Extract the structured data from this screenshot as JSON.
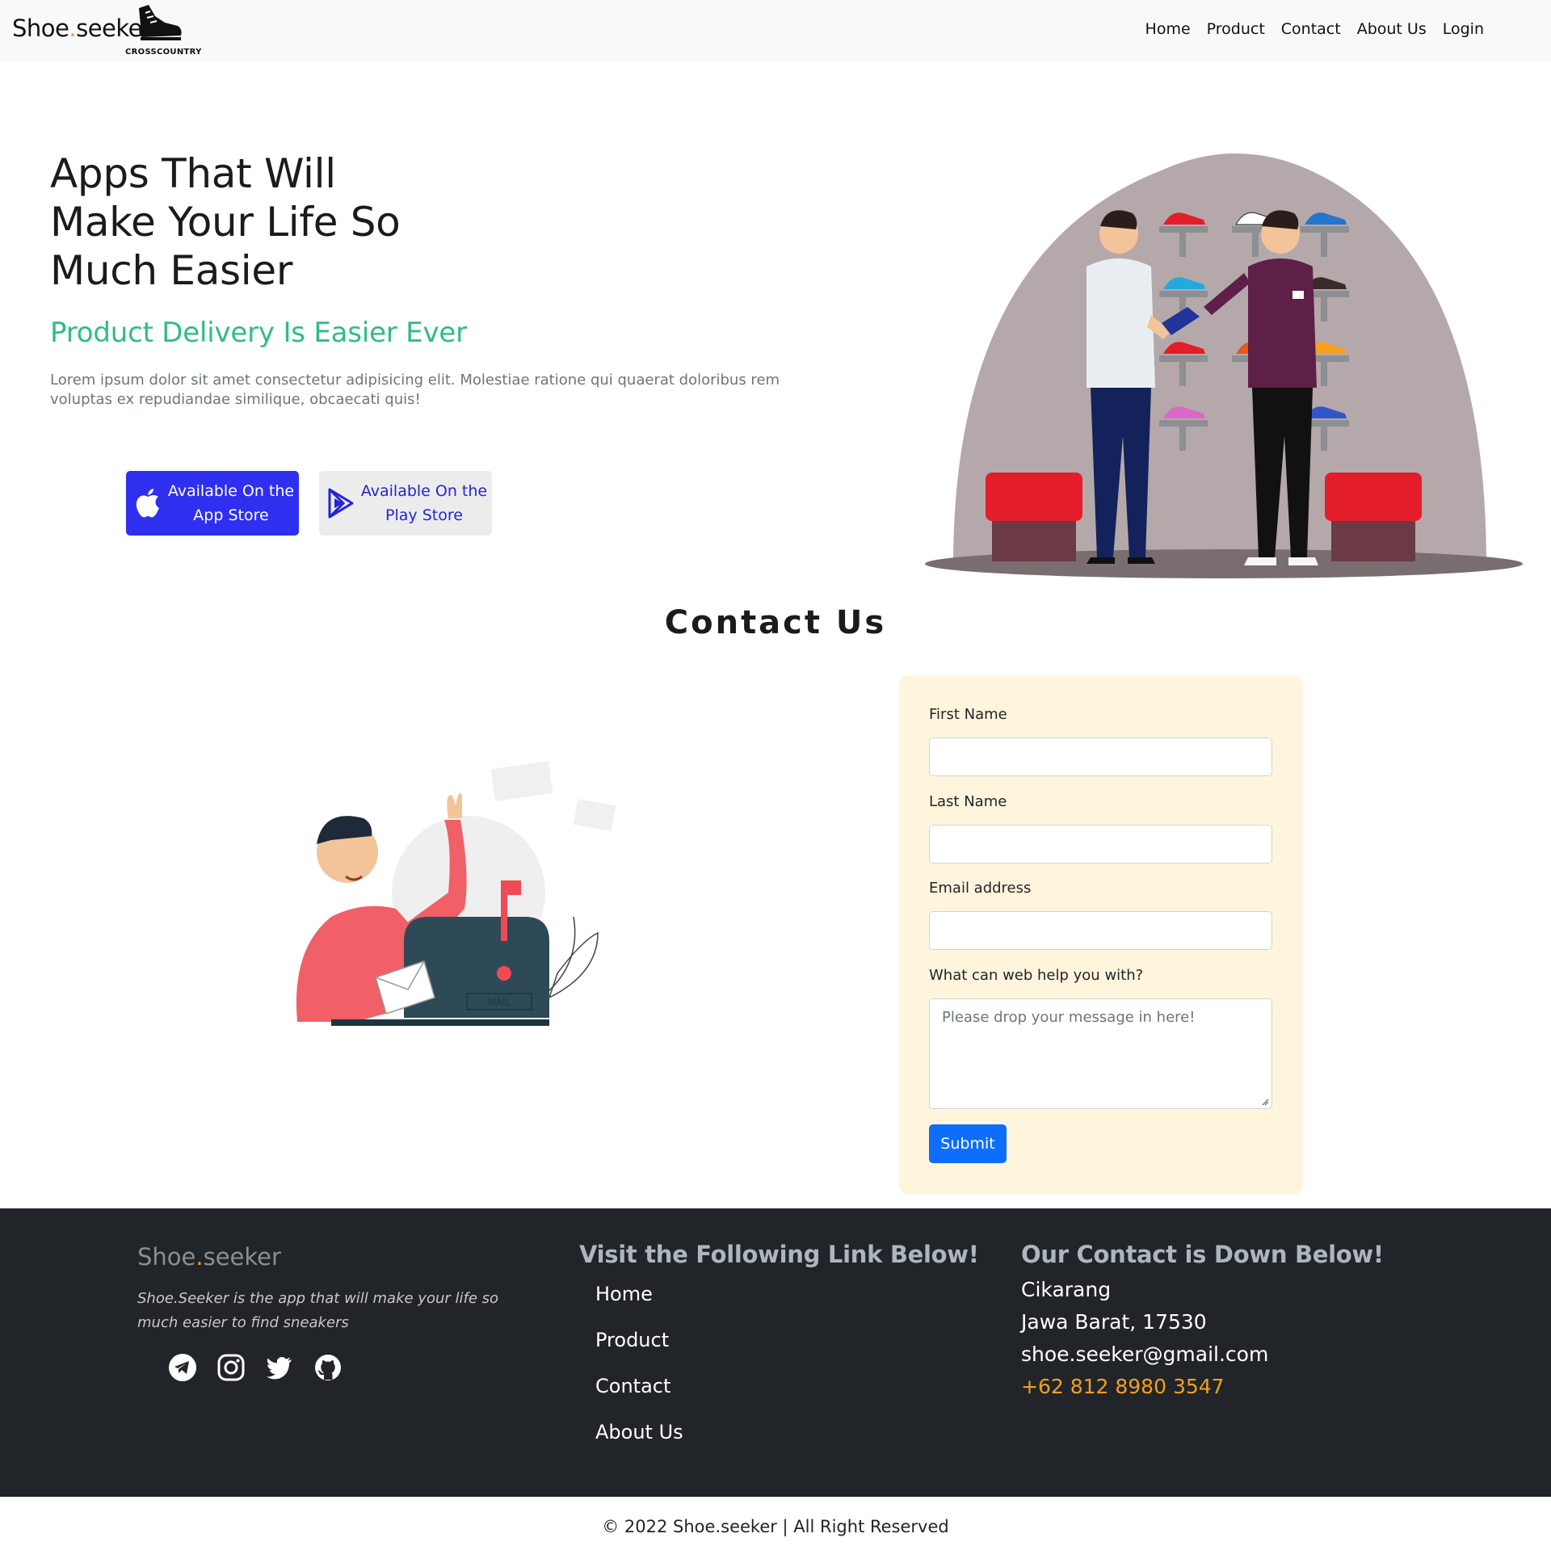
{
  "navbar": {
    "brand_first": "Shoe",
    "brand_dot": ".",
    "brand_second": "seeker",
    "brand_sub": "CROSSCOUNTRY",
    "links": [
      "Home",
      "Product",
      "Contact",
      "About Us",
      "Login"
    ]
  },
  "hero": {
    "title": "Apps That Will Make Your Life So Much Easier",
    "subtitle": "Product Delivery Is Easier Ever",
    "description": "Lorem ipsum dolor sit amet consectetur adipisicing elit. Molestiae ratione qui quaerat doloribus rem voluptas ex repudiandae similique, obcaecati quis!",
    "app_store_label": "Available On the App Store",
    "play_store_label": "Available On the Play Store"
  },
  "contact": {
    "title": "Contact Us",
    "first_name_label": "First Name",
    "last_name_label": "Last Name",
    "email_label": "Email address",
    "message_label": "What can web help you with?",
    "message_placeholder": "Please drop your message in here!",
    "submit_label": "Submit",
    "mailbox_text": "MAIL"
  },
  "footer": {
    "brand_first": "Shoe",
    "brand_dot": ".",
    "brand_second": "seeker",
    "tagline": "Shoe.Seeker is the app that will make your life so much easier to find sneakers",
    "links_heading": "Visit the Following Link Below!",
    "links": [
      "Home",
      "Product",
      "Contact",
      "About Us"
    ],
    "contact_heading": "Our Contact is Down Below!",
    "city": "Cikarang",
    "region": "Jawa Barat, 17530",
    "email": "shoe.seeker@gmail.com",
    "phone": "+62 812 8980 3547",
    "social_icons": [
      "telegram-icon",
      "instagram-icon",
      "twitter-icon",
      "github-icon"
    ]
  },
  "copyright": "© 2022 Shoe.seeker | All Right Reserved",
  "colors": {
    "accent_green": "#2ebd85",
    "primary_blue": "#0d6efd",
    "app_store_blue": "#2f2ff0",
    "form_bg": "#fff5dc",
    "footer_bg": "#212529",
    "phone_orange": "#f0a020"
  }
}
